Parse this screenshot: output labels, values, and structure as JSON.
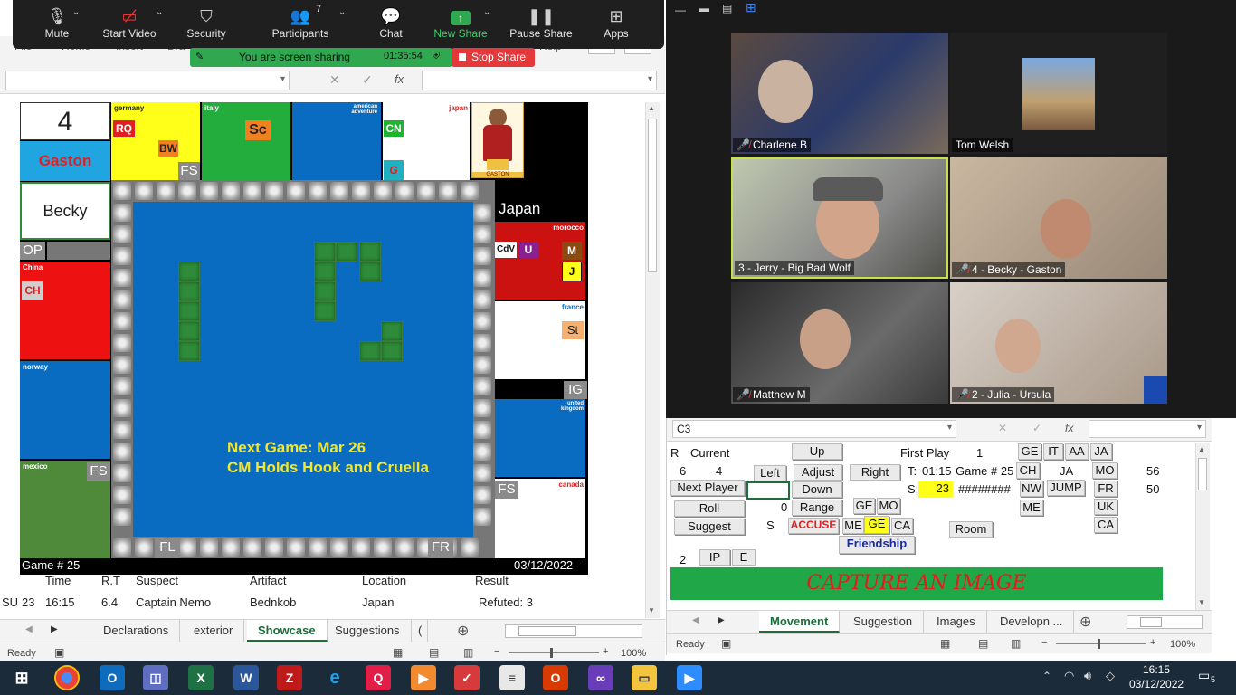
{
  "zoom": {
    "toolbar": [
      {
        "label": "Mute",
        "icon": "microphone-icon"
      },
      {
        "label": "Start Video",
        "icon": "video-off-icon"
      },
      {
        "label": "Security",
        "icon": "shield-icon"
      },
      {
        "label": "Participants",
        "icon": "participants-icon",
        "count": "7"
      },
      {
        "label": "Chat",
        "icon": "chat-icon"
      },
      {
        "label": "New Share",
        "icon": "share-icon"
      },
      {
        "label": "Pause Share",
        "icon": "pause-icon"
      },
      {
        "label": "Apps",
        "icon": "apps-icon"
      }
    ],
    "sharing_text": "You are screen sharing",
    "sharing_timer": "01:35:54",
    "stop_share": "Stop Share",
    "participants": [
      {
        "name": "Charlene B",
        "muted": true
      },
      {
        "name": "Tom Welsh",
        "muted": false
      },
      {
        "name": "3 - Jerry - Big Bad Wolf",
        "muted": false
      },
      {
        "name": "4 - Becky - Gaston",
        "muted": true
      },
      {
        "name": "Matthew M",
        "muted": true
      },
      {
        "name": "2 - Julia - Ursula",
        "muted": true
      }
    ]
  },
  "left_excel": {
    "ribbon_partial": [
      "File",
      "Home",
      "Insert",
      "Dra",
      "Help"
    ],
    "board": {
      "big_number": "4",
      "player_name": "Gaston",
      "player2_name": "Becky",
      "portrait_caption": "GASTON",
      "countries": {
        "germany": "germany",
        "italy": "italy",
        "american": "american adventure",
        "japan_small": "japan",
        "japan": "Japan",
        "morocco": "morocco",
        "china": "China",
        "france": "france",
        "norway": "norway",
        "uk": "united kingdom",
        "mexico": "mexico",
        "canada": "canada"
      },
      "tags": {
        "rq": "RQ",
        "bw": "BW",
        "sc": "Sc",
        "cn": "CN",
        "g": "G",
        "ch": "CH",
        "cdv": "CdV",
        "u": "U",
        "m": "M",
        "j": "J",
        "st": "St"
      },
      "corner_labels": {
        "fs1": "FS",
        "op": "OP",
        "fs2": "FS",
        "fs3": "FS",
        "fs4": "FS",
        "ig": "IG",
        "fl": "FL",
        "fr": "FR"
      },
      "announcement_line1": "Next Game: Mar 26",
      "announcement_line2": "CM Holds Hook and Cruella",
      "game_label": "Game # 25",
      "date_label": "03/12/2022"
    },
    "table": {
      "headers": [
        "Time",
        "R.T",
        "Suspect",
        "Artifact",
        "Location",
        "Result"
      ],
      "row": {
        "id": "SU",
        "num": "23",
        "time": "16:15",
        "rt": "6.4",
        "suspect": "Captain Nemo",
        "artifact": "Bednkob",
        "location": "Japan",
        "result": "Refuted: 3"
      }
    },
    "tabs": [
      "Declarations",
      "exterior",
      "Showcase",
      "Suggestions",
      "("
    ],
    "active_tab": "Showcase",
    "status": "Ready",
    "zoom_pct": "100%"
  },
  "right_excel": {
    "name_box": "C3",
    "grid": {
      "r": "R",
      "current": "Current",
      "v6": "6",
      "v4": "4",
      "up": "Up",
      "left": "Left",
      "adjust": "Adjust",
      "right": "Right",
      "down": "Down",
      "next_player": "Next Player",
      "roll": "Roll",
      "zero": "0",
      "range": "Range",
      "suggest": "Suggest",
      "s": "S",
      "accuse": "ACCUSE",
      "first_play": "First Play",
      "one": "1",
      "t_label": "T:",
      "t_value": "01:15",
      "game_label": "Game # 25",
      "s_label": "S:",
      "s_value": "23",
      "hashes": "########",
      "ge1": "GE",
      "mo1": "MO",
      "me1": "ME",
      "ge2": "GE",
      "ca1": "CA",
      "friendship": "Friendship",
      "room": "Room",
      "ge3": "GE",
      "it": "IT",
      "aa": "AA",
      "ja1": "JA",
      "ch": "CH",
      "ja2": "JA",
      "mo2": "MO",
      "v56": "56",
      "nw": "NW",
      "jump": "JUMP",
      "fr": "FR",
      "v50": "50",
      "me2": "ME",
      "uk": "UK",
      "ca2": "CA",
      "two": "2",
      "ip": "IP",
      "e": "E",
      "capture": "CAPTURE AN IMAGE"
    },
    "tabs": [
      "Movement",
      "Suggestion",
      "Images",
      "Developn ..."
    ],
    "active_tab": "Movement",
    "status": "Ready",
    "zoom_pct": "100%"
  },
  "taskbar": {
    "time": "16:15",
    "date": "03/12/2022",
    "notifications": "5"
  },
  "colors": {
    "board_blue": "#0a6cc0",
    "yellow_text": "#f4e62a",
    "zoom_green": "#2fa84f",
    "stop_red": "#e5383b"
  }
}
